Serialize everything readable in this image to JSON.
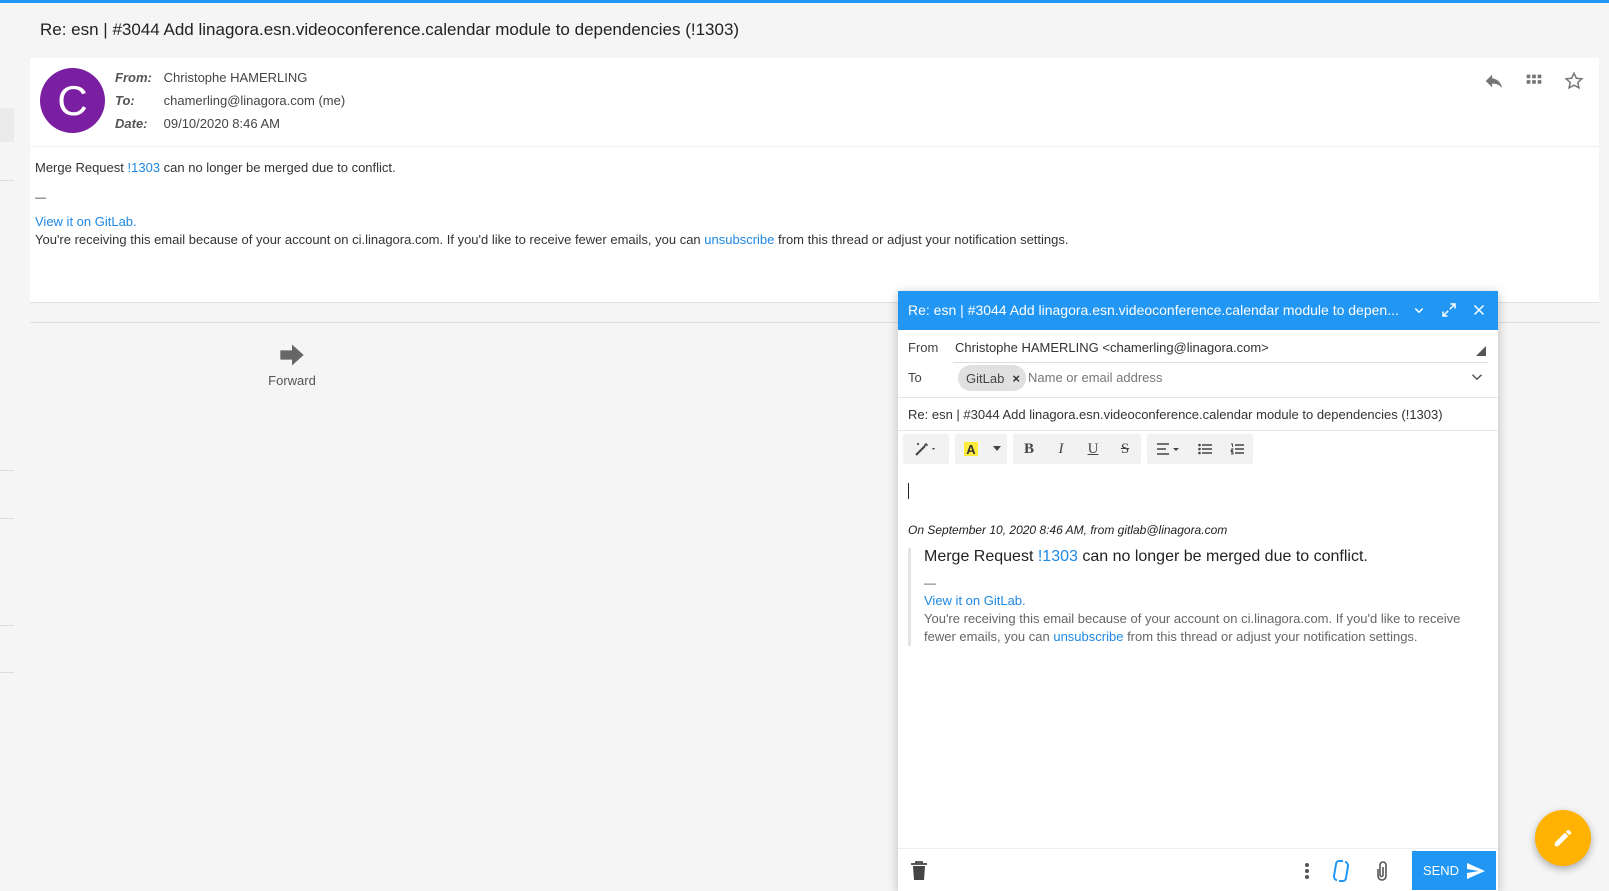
{
  "subject": "Re: esn | #3044 Add linagora.esn.videoconference.calendar module to dependencies (!1303)",
  "message": {
    "avatar_letter": "C",
    "avatar_color": "#7b1fa2",
    "from_label": "From:",
    "from_value": "Christophe HAMERLING",
    "to_label": "To:",
    "to_value": "chamerling@linagora.com (me)",
    "date_label": "Date:",
    "date_value": "09/10/2020 8:46 AM",
    "actions": [
      "reply-icon",
      "apps-grid-icon",
      "star-outline-icon"
    ],
    "body": {
      "line1_prefix": "Merge Request ",
      "line1_link": "!1303",
      "line1_suffix": " can no longer be merged due to conflict.",
      "dash": "—",
      "view_link": "View it on GitLab",
      "view_suffix": ".",
      "notice_prefix": "You're receiving this email because of your account on ci.linagora.com. If you'd like to receive fewer emails, you can ",
      "unsubscribe_link": "unsubscribe",
      "notice_suffix": " from this thread or adjust your notification settings."
    }
  },
  "forward_label": "Forward",
  "composer": {
    "header_title": "Re: esn | #3044 Add linagora.esn.videoconference.calendar module to depen...",
    "header_color": "#2196f3",
    "from_label": "From",
    "from_value": "Christophe HAMERLING <chamerling@linagora.com>",
    "to_label": "To",
    "recipient_chip": "GitLab",
    "to_placeholder": "Name or email address",
    "subject_value": "Re: esn | #3044 Add linagora.esn.videoconference.calendar module to dependencies (!1303)",
    "toolbar": {
      "bold": "B",
      "italic": "I",
      "underline": "U",
      "strike": "S",
      "highlight_color": "#ffeb3b"
    },
    "quote_header": "On September 10, 2020 8:46 AM, from gitlab@linagora.com",
    "quote": {
      "line1_prefix": "Merge Request ",
      "line1_link": "!1303",
      "line1_suffix": " can no longer be merged due to conflict.",
      "dash": "—",
      "view_link": "View it on GitLab",
      "view_suffix": ".",
      "notice_line1": "You're receiving this email because of your account on ci.linagora.com. If you'd like to receive",
      "notice_line2_prefix": "fewer emails, you can ",
      "unsubscribe_link": "unsubscribe",
      "notice_line2_suffix": " from this thread or adjust your notification settings."
    },
    "send_label": "SEND"
  },
  "fab_color": "#ffb300"
}
